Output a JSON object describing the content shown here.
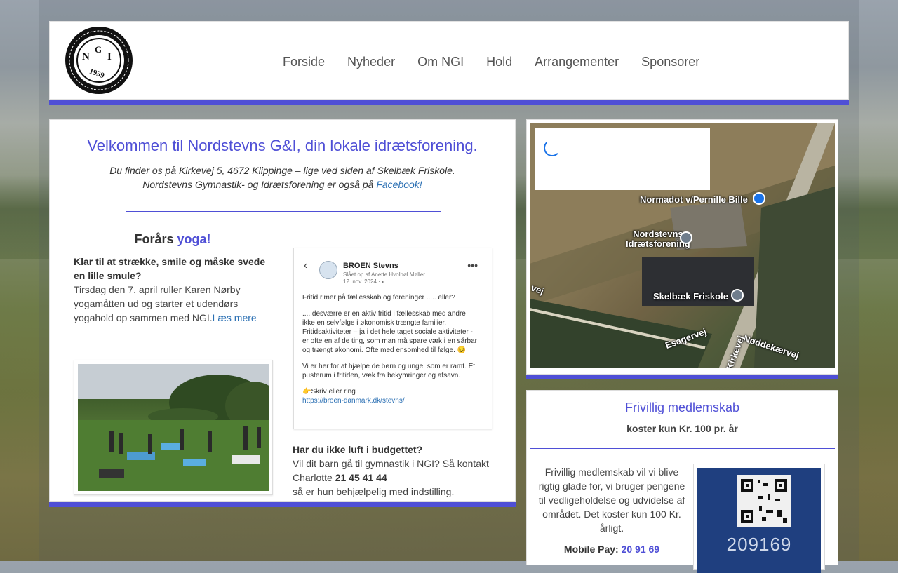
{
  "nav": {
    "items": [
      "Forside",
      "Nyheder",
      "Om NGI",
      "Hold",
      "Arrangementer",
      "Sponsorer"
    ]
  },
  "logo": {
    "alt": "NORDSTEVNS GYMNASTIK & IDRÆTSFORENING",
    "letters": "N G I",
    "year": "1959"
  },
  "main": {
    "welcome": "Velkommen til Nordstevns G&I, din lokale idrætsforening.",
    "intro_line1": "Du finder os på Kirkevej 5, 4672 Klippinge – lige ved siden af Skelbæk Friskole.",
    "intro_line2": "Nordstevns Gymnastik- og Idrætsforening er også på ",
    "facebook_link": "Facebook!",
    "yoga_title_prefix": "Forårs ",
    "yoga_title_link": "yoga!",
    "yoga_bold": "Klar til at strække, smile og måske svede en lille smule?",
    "yoga_text": "Tirsdag den 7. april ruller Karen Nørby yogamåtten ud og starter et udendørs yogahold op sammen med NGI.",
    "read_more": "Læs mere",
    "budget_title": "Har du ikke luft i budgettet?",
    "budget_text": "Vil dit barn gå til gymnastik i NGI? Så kontakt Charlotte ",
    "budget_phone": "21 45 41 44",
    "budget_end": "så er hun behjælpelig med indstilling."
  },
  "facebook_post": {
    "name": "BROEN Stevns",
    "meta1": "Slået op af Anette Hvolbøl Møller",
    "meta2": "12. nov. 2024 · ",
    "p1": "Fritid rimer på fællesskab og foreninger ..... eller?",
    "p2": ".... desværre er en aktiv fritid i fællesskab med andre ikke en selvfølge i økonomisk trængte familier. Fritidsaktiviteter – ja i det hele taget sociale aktiviteter - er ofte en af de ting, som man må spare væk i en sårbar og trængt økonomi. Ofte med ensomhed til følge. 😔",
    "p3": "Vi er her for at hjælpe de børn og unge, som er ramt. Et pusterum i fritiden, væk fra bekymringer og afsavn.",
    "p4": "👉Skriv eller ring",
    "link": "https://broen-danmark.dk/stevns/"
  },
  "map": {
    "labels": [
      "Normadot v/Pernille Bille",
      "Nordstevns",
      "Idrætsforening",
      "Skelbæk Friskole",
      "Esagervej",
      "Nøddekærvej",
      "Kirkevej",
      "vej"
    ]
  },
  "membership": {
    "title": "Frivillig medlemskab",
    "subtitle": "koster kun Kr. 100 pr. år",
    "text": "Frivillig medlemskab vil vi blive rigtig glade for, vi bruger pengene til vedligeholdelse og udvidelse af området. Det koster kun 100 Kr. årligt.",
    "mobilepay_label": "Mobile Pay: ",
    "mobilepay_number": "20 91 69",
    "qr_number": "209169"
  },
  "colors": {
    "accent": "#4f4fd6",
    "link": "#2a6fb3"
  }
}
